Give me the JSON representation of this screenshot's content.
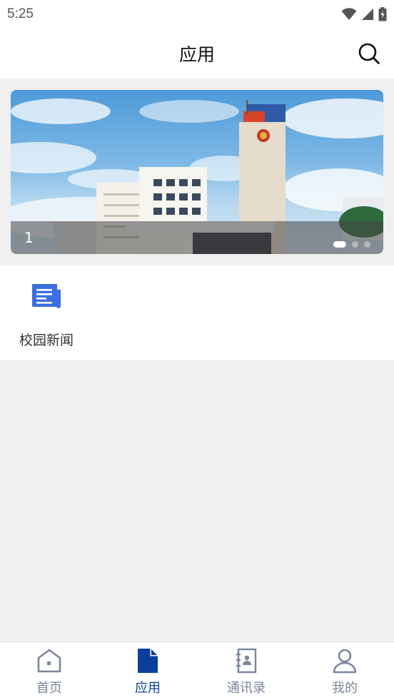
{
  "status_bar": {
    "time": "5:25"
  },
  "header": {
    "title": "应用",
    "search_icon": "search-icon"
  },
  "banner": {
    "index": "1",
    "total_slides": 3,
    "active_slide": 1
  },
  "apps": [
    {
      "label": "校园新闻",
      "icon": "news-icon",
      "color": "#3b6fe0"
    }
  ],
  "bottom_nav": {
    "items": [
      {
        "label": "首页",
        "icon": "home-icon"
      },
      {
        "label": "应用",
        "icon": "document-icon",
        "active": true
      },
      {
        "label": "通讯录",
        "icon": "contacts-icon"
      },
      {
        "label": "我的",
        "icon": "user-icon"
      }
    ],
    "active_color": "#0b3f9e",
    "inactive_color": "#7a869a"
  }
}
